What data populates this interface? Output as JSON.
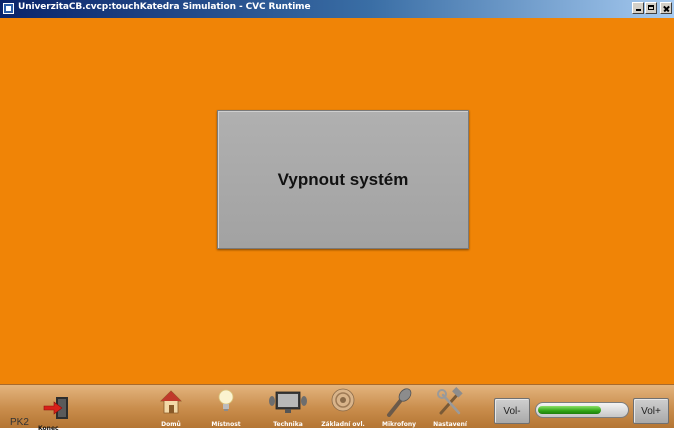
{
  "window": {
    "title": "UniverzitaCB.cvcp:touchKatedra Simulation - CVC Runtime"
  },
  "main": {
    "shutdown_label": "Vypnout systém"
  },
  "bottombar": {
    "pk_label": "PK2",
    "exit_label": "Konec",
    "nav": [
      {
        "label": "Domů",
        "icon": "home-icon"
      },
      {
        "label": "Místnost",
        "icon": "lightbulb-icon"
      },
      {
        "label": "Technika",
        "icon": "monitor-icon"
      },
      {
        "label": "Základní ovl.",
        "icon": "disc-icon"
      },
      {
        "label": "Mikrofony",
        "icon": "microphone-icon"
      },
      {
        "label": "Nastavení",
        "icon": "tools-icon"
      }
    ],
    "vol_down_label": "Vol-",
    "vol_up_label": "Vol+",
    "volume_level": 0.72
  },
  "colors": {
    "panel_background": "#f08406",
    "button_gray": "#a8a8a8",
    "volume_green": "#2fa514"
  }
}
